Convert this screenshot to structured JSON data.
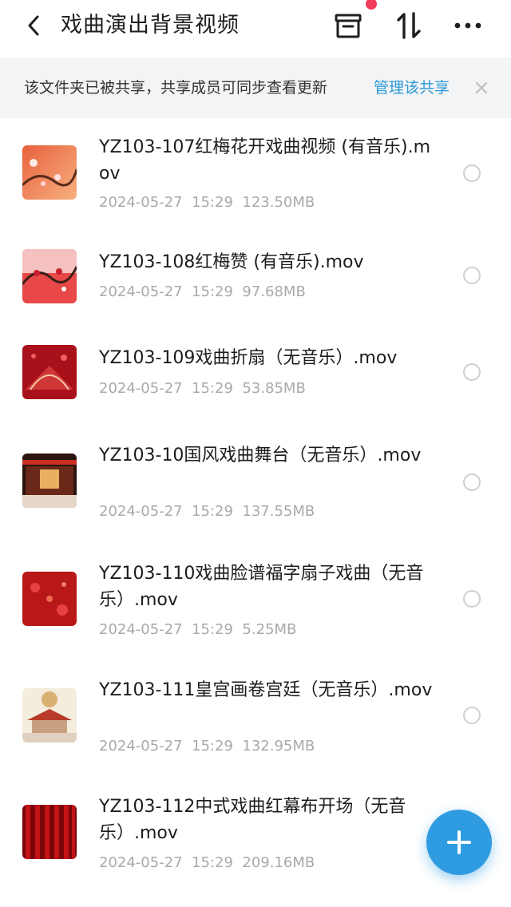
{
  "header": {
    "title": "戏曲演出背景视频"
  },
  "banner": {
    "text": "该文件夹已被共享，共享成员可同步查看更新",
    "link": "管理该共享"
  },
  "files": [
    {
      "name": "YZ103-107红梅花开戏曲视频 (有音乐).mov",
      "date": "2024-05-27",
      "time": "15:29",
      "size": "123.50MB"
    },
    {
      "name": "YZ103-108红梅赞 (有音乐).mov",
      "date": "2024-05-27",
      "time": "15:29",
      "size": "97.68MB"
    },
    {
      "name": "YZ103-109戏曲折扇（无音乐）.mov",
      "date": "2024-05-27",
      "time": "15:29",
      "size": "53.85MB"
    },
    {
      "name": "YZ103-10国风戏曲舞台（无音乐）.mov",
      "date": "2024-05-27",
      "time": "15:29",
      "size": "137.55MB"
    },
    {
      "name": "YZ103-110戏曲脸谱福字扇子戏曲（无音乐）.mov",
      "date": "2024-05-27",
      "time": "15:29",
      "size": "5.25MB"
    },
    {
      "name": "YZ103-111皇宫画卷宫廷（无音乐）.mov",
      "date": "2024-05-27",
      "time": "15:29",
      "size": "132.95MB"
    },
    {
      "name": "YZ103-112中式戏曲红幕布开场（无音乐）.mov",
      "date": "2024-05-27",
      "time": "15:29",
      "size": "209.16MB"
    }
  ]
}
